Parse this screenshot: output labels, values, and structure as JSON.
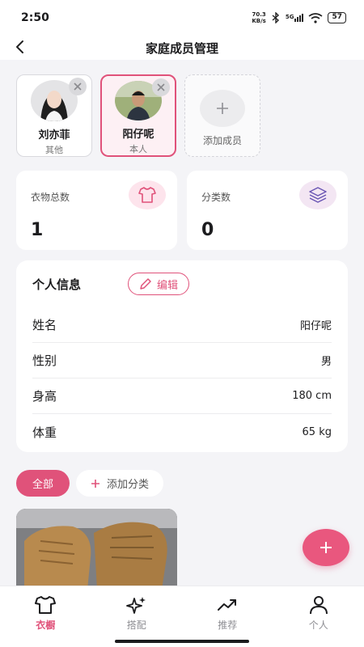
{
  "status": {
    "time": "2:50",
    "net_speed_value": "70.3",
    "net_speed_unit": "KB/s",
    "signal_label": "5G",
    "battery": "57"
  },
  "nav": {
    "title": "家庭成员管理"
  },
  "members": [
    {
      "name": "刘亦菲",
      "role": "其他"
    },
    {
      "name": "阳仔呢",
      "role": "本人",
      "selected": true
    },
    {
      "add_label": "添加成员"
    }
  ],
  "stats": {
    "clothes": {
      "label": "衣物总数",
      "value": "1"
    },
    "categories": {
      "label": "分类数",
      "value": "0"
    }
  },
  "profile": {
    "title": "个人信息",
    "edit_label": "编辑",
    "rows": [
      {
        "key": "姓名",
        "value": "阳仔呢"
      },
      {
        "key": "性别",
        "value": "男"
      },
      {
        "key": "身高",
        "value": "180 cm"
      },
      {
        "key": "体重",
        "value": "65 kg"
      }
    ]
  },
  "categories": {
    "all_label": "全部",
    "add_label": "添加分类"
  },
  "fab": {
    "icon": "plus-icon"
  },
  "tabs": [
    {
      "label": "衣橱",
      "icon": "tshirt-icon",
      "active": true
    },
    {
      "label": "搭配",
      "icon": "sparkle-icon"
    },
    {
      "label": "推荐",
      "icon": "trending-icon"
    },
    {
      "label": "个人",
      "icon": "person-icon"
    }
  ],
  "colors": {
    "accent": "#e0527a",
    "background": "#f4f4f7",
    "card": "#ffffff"
  }
}
